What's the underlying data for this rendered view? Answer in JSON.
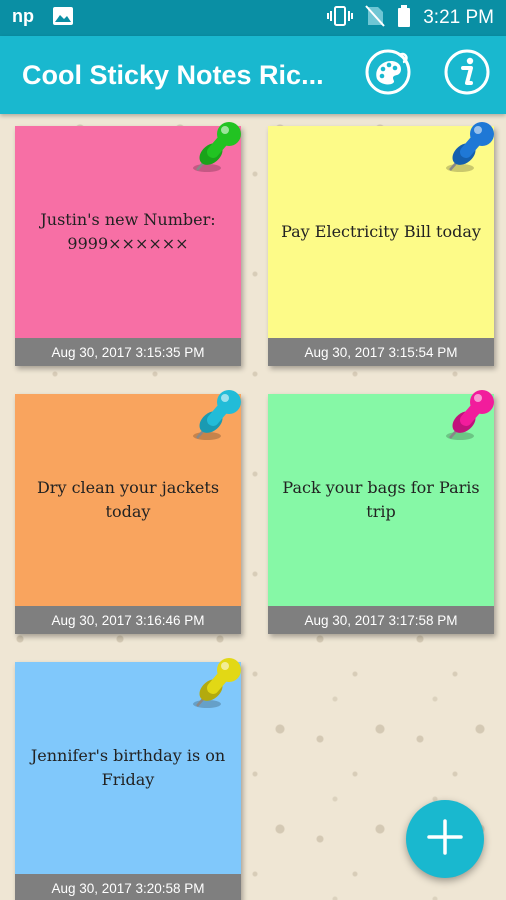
{
  "status_bar": {
    "time": "3:21 PM",
    "icons": [
      "notification-np-icon",
      "image-icon",
      "vibrate-icon",
      "no-sim-icon",
      "battery-icon"
    ]
  },
  "app_bar": {
    "title": "Cool Sticky Notes Ric...",
    "actions": [
      "palette-icon",
      "info-icon"
    ]
  },
  "notes": [
    {
      "text": "Justin's new Number: 9999××××××",
      "date": "Aug 30, 2017 3:15:35 PM",
      "color": "#f76fa5",
      "pin_color": "#22c322"
    },
    {
      "text": "Pay Electricity Bill today",
      "date": "Aug 30, 2017 3:15:54 PM",
      "color": "#fdfb88",
      "pin_color": "#1f78d6"
    },
    {
      "text": "Dry clean your jackets today",
      "date": "Aug 30, 2017 3:16:46 PM",
      "color": "#f9a45e",
      "pin_color": "#22bcd8"
    },
    {
      "text": "Pack your bags for Paris trip",
      "date": "Aug 30, 2017 3:17:58 PM",
      "color": "#86f8a6",
      "pin_color": "#f21c9c"
    },
    {
      "text": "Jennifer's birthday is on Friday",
      "date": "Aug 30, 2017 3:20:58 PM",
      "color": "#80c8fb",
      "pin_color": "#e2d815"
    }
  ],
  "fab": {
    "icon": "plus-icon"
  },
  "colors": {
    "status_bar": "#0a8fa4",
    "app_bar": "#19b8cf",
    "background": "#efe6d4",
    "footer": "#7f7f7f"
  }
}
